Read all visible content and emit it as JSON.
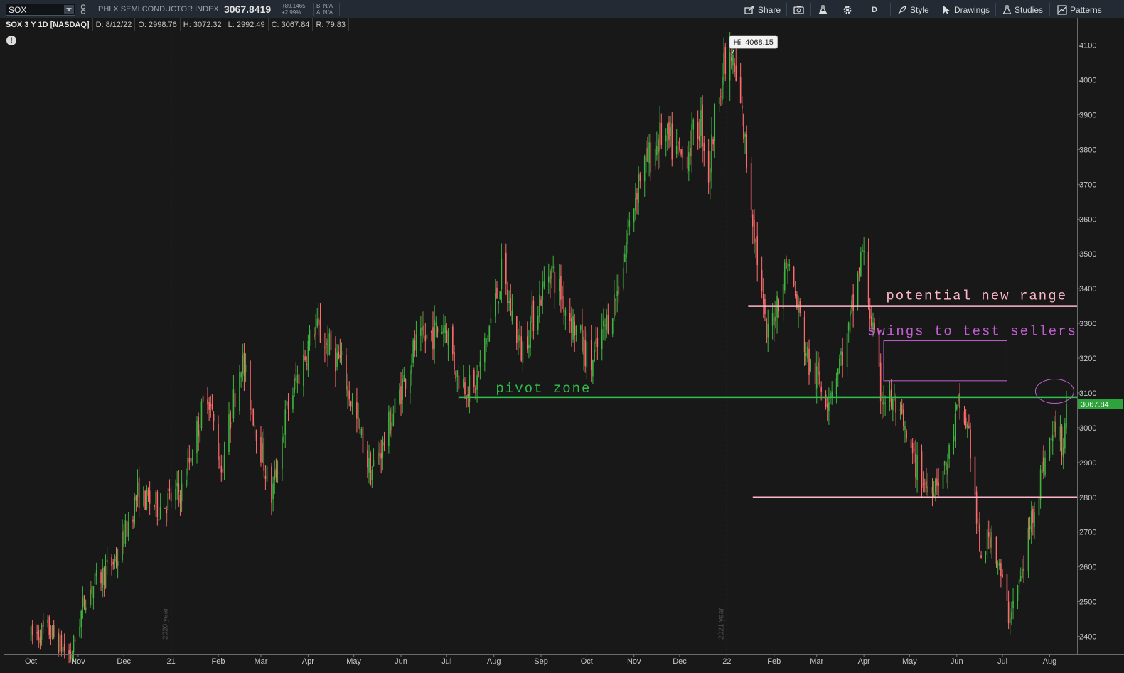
{
  "header": {
    "symbol_value": "SOX",
    "description": "PHLX SEMI CONDUCTOR INDEX",
    "last_price": "3067.8419",
    "change_abs": "+89.1465",
    "change_pct": "+2.99%",
    "bid": "B: N/A",
    "ask": "A: N/A"
  },
  "toolbar": {
    "share_label": "Share",
    "aggregation_label": "D",
    "style_label": "Style",
    "drawings_label": "Drawings",
    "studies_label": "Studies",
    "patterns_label": "Patterns"
  },
  "info_bar": {
    "title": "SOX 3 Y 1D [NASDAQ]",
    "date": "D: 8/12/22",
    "open": "O: 2998.76",
    "high": "H: 3072.32",
    "low": "L: 2992.49",
    "close": "C: 3067.84",
    "range": "R: 79.83"
  },
  "alert_text": "!",
  "colors": {
    "up": "#3fb43f",
    "down": "#ff6b6b",
    "background": "#181818",
    "pivot_line": "#2ec04a",
    "range_line": "#ffb6c8",
    "swing_text": "#c060d0",
    "price_badge": "#2ea23b"
  },
  "chart_data": {
    "type": "candlestick",
    "title": "SOX 3 Y 1D [NASDAQ]",
    "ylim": [
      2350,
      4140
    ],
    "y_ticks": [
      2400,
      2500,
      2600,
      2700,
      2800,
      2900,
      3000,
      3100,
      3200,
      3300,
      3400,
      3500,
      3600,
      3700,
      3800,
      3900,
      4000,
      4100
    ],
    "x_ticks": [
      "Oct",
      "Nov",
      "Dec",
      "21",
      "Feb",
      "Mar",
      "Apr",
      "May",
      "Jun",
      "Jul",
      "Aug",
      "Sep",
      "Oct",
      "Nov",
      "Dec",
      "22",
      "Feb",
      "Mar",
      "Apr",
      "May",
      "Jun",
      "Jul",
      "Aug"
    ],
    "year_markers": [
      "2020 year",
      "2021 year"
    ],
    "last_price_label": "3067.84",
    "high_label": "Hi: 4068.15",
    "path_keypoints": [
      {
        "date": "2020-10-01",
        "price": 2400
      },
      {
        "date": "2020-10-12",
        "price": 2420
      },
      {
        "date": "2020-10-27",
        "price": 2340
      },
      {
        "date": "2020-11-06",
        "price": 2520
      },
      {
        "date": "2020-11-27",
        "price": 2630
      },
      {
        "date": "2020-12-10",
        "price": 2810
      },
      {
        "date": "2020-12-24",
        "price": 2770
      },
      {
        "date": "2021-01-08",
        "price": 2820
      },
      {
        "date": "2021-01-25",
        "price": 3110
      },
      {
        "date": "2021-02-03",
        "price": 2880
      },
      {
        "date": "2021-02-16",
        "price": 3200
      },
      {
        "date": "2021-03-08",
        "price": 2800
      },
      {
        "date": "2021-03-18",
        "price": 3050
      },
      {
        "date": "2021-04-05",
        "price": 3290
      },
      {
        "date": "2021-04-23",
        "price": 3180
      },
      {
        "date": "2021-05-12",
        "price": 2870
      },
      {
        "date": "2021-05-20",
        "price": 2950
      },
      {
        "date": "2021-06-10",
        "price": 3230
      },
      {
        "date": "2021-06-30",
        "price": 3300
      },
      {
        "date": "2021-07-08",
        "price": 3150
      },
      {
        "date": "2021-07-19",
        "price": 3100
      },
      {
        "date": "2021-08-06",
        "price": 3440
      },
      {
        "date": "2021-08-19",
        "price": 3220
      },
      {
        "date": "2021-09-07",
        "price": 3460
      },
      {
        "date": "2021-09-20",
        "price": 3320
      },
      {
        "date": "2021-10-04",
        "price": 3180
      },
      {
        "date": "2021-10-21",
        "price": 3390
      },
      {
        "date": "2021-11-04",
        "price": 3720
      },
      {
        "date": "2021-11-19",
        "price": 3840
      },
      {
        "date": "2021-12-03",
        "price": 3770
      },
      {
        "date": "2021-12-15",
        "price": 3880
      },
      {
        "date": "2021-12-20",
        "price": 3730
      },
      {
        "date": "2021-12-27",
        "price": 4000
      },
      {
        "date": "2022-01-04",
        "price": 4060
      },
      {
        "date": "2022-01-11",
        "price": 3890
      },
      {
        "date": "2022-01-27",
        "price": 3250
      },
      {
        "date": "2022-02-10",
        "price": 3480
      },
      {
        "date": "2022-02-24",
        "price": 3180
      },
      {
        "date": "2022-03-08",
        "price": 3090
      },
      {
        "date": "2022-03-21",
        "price": 3250
      },
      {
        "date": "2022-03-31",
        "price": 3510
      },
      {
        "date": "2022-04-12",
        "price": 3100
      },
      {
        "date": "2022-04-22",
        "price": 3060
      },
      {
        "date": "2022-05-02",
        "price": 2920
      },
      {
        "date": "2022-05-12",
        "price": 2830
      },
      {
        "date": "2022-05-25",
        "price": 2880
      },
      {
        "date": "2022-06-02",
        "price": 3060
      },
      {
        "date": "2022-06-09",
        "price": 2990
      },
      {
        "date": "2022-06-16",
        "price": 2630
      },
      {
        "date": "2022-06-24",
        "price": 2700
      },
      {
        "date": "2022-07-05",
        "price": 2460
      },
      {
        "date": "2022-07-14",
        "price": 2580
      },
      {
        "date": "2022-07-20",
        "price": 2740
      },
      {
        "date": "2022-07-29",
        "price": 2920
      },
      {
        "date": "2022-08-05",
        "price": 3000
      },
      {
        "date": "2022-08-10",
        "price": 2950
      },
      {
        "date": "2022-08-12",
        "price": 3068
      }
    ],
    "annotations": [
      {
        "text": "potential new range",
        "type": "horizontal_line",
        "price": 3350,
        "from_date": "2022-01-15",
        "color": "#ffb6c8"
      },
      {
        "text": "swings to test sellers",
        "type": "rectangle",
        "price_top": 3250,
        "price_bottom": 3135,
        "from_date": "2022-04-14",
        "to_date": "2022-07-04",
        "color": "#c060d0"
      },
      {
        "text": "pivot zone",
        "type": "horizontal_line",
        "price": 3088,
        "from_date": "2021-07-09",
        "color": "#2ec04a"
      },
      {
        "text": "",
        "type": "horizontal_line",
        "price": 2800,
        "from_date": "2022-01-18",
        "color": "#ffb6c8"
      },
      {
        "text": "",
        "type": "ellipse",
        "price": 3105,
        "date": "2022-08-08",
        "color": "#c060d0"
      }
    ]
  }
}
